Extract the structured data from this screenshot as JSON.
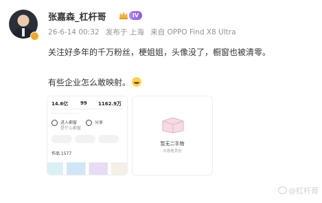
{
  "post": {
    "author": "张嘉森_杠杆哥",
    "level": "IV",
    "date": "26-6-14 00:32",
    "location": "发布于 上海",
    "source": "来自 OPPO Find X8 Ultra",
    "line1": "关注好多年的千万粉丝，梗姐姐，头像没了，橱窗也被清零。",
    "line2": "有些企业怎么敢映射。"
  },
  "image1": {
    "stat1": "14.6亿",
    "stat2": "99",
    "stat3": "1162.9万",
    "tag1": "进入橱窗",
    "tag1_sub": "是什么橱窗",
    "tag2": "分享",
    "count": "作品 1577"
  },
  "image2": {
    "title": "暂无二手物",
    "sub": "去看看其他"
  },
  "watermark": "@杠杆哥"
}
